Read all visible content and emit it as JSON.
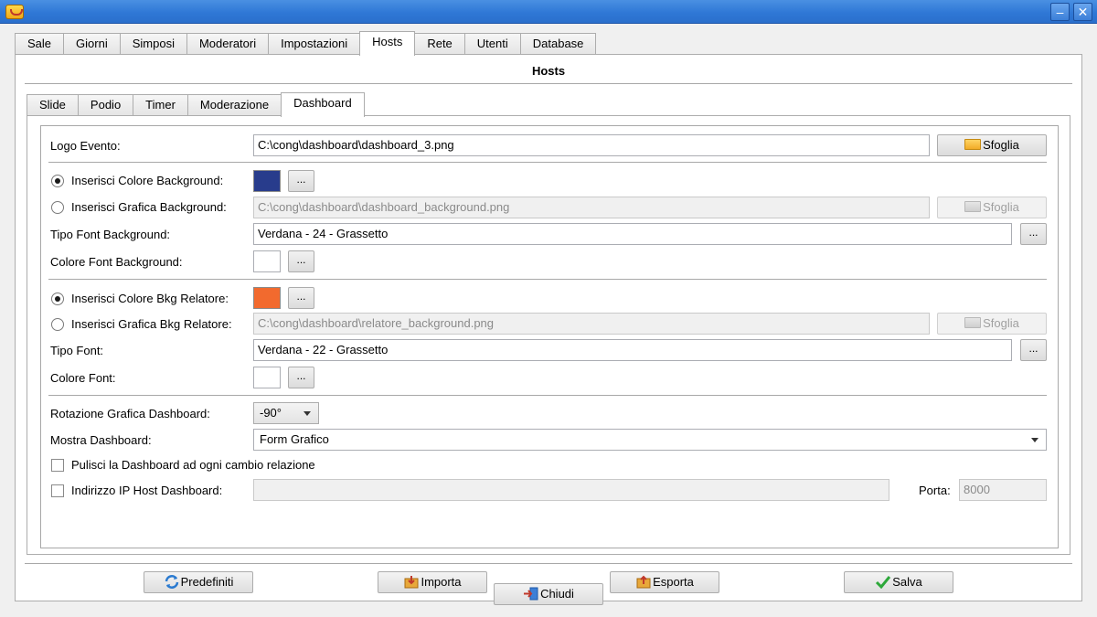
{
  "outer_tabs": [
    "Sale",
    "Giorni",
    "Simposi",
    "Moderatori",
    "Impostazioni",
    "Hosts",
    "Rete",
    "Utenti",
    "Database"
  ],
  "outer_active": "Hosts",
  "panel_title": "Hosts",
  "inner_tabs": [
    "Slide",
    "Podio",
    "Timer",
    "Moderazione",
    "Dashboard"
  ],
  "inner_active": "Dashboard",
  "form": {
    "logo_label": "Logo Evento:",
    "logo_value": "C:\\cong\\dashboard\\dashboard_3.png",
    "browse_label": "Sfoglia",
    "dots_label": "...",
    "bg_color_radio": "Inserisci Colore Background:",
    "bg_color": "#283c8c",
    "bg_graphic_radio": "Inserisci Grafica Background:",
    "bg_graphic_value": "C:\\cong\\dashboard\\dashboard_background.png",
    "bg_font_label": "Tipo Font Background:",
    "bg_font_value": "Verdana - 24 - Grassetto",
    "bg_font_color_label": "Colore Font Background:",
    "rel_color_radio": "Inserisci Colore Bkg Relatore:",
    "rel_color": "#f26a2e",
    "rel_graphic_radio": "Inserisci Grafica Bkg Relatore:",
    "rel_graphic_value": "C:\\cong\\dashboard\\relatore_background.png",
    "font_label": "Tipo Font:",
    "font_value": "Verdana - 22 - Grassetto",
    "font_color_label": "Colore Font:",
    "rotation_label": "Rotazione Grafica Dashboard:",
    "rotation_value": "-90°",
    "show_label": "Mostra Dashboard:",
    "show_value": "Form Grafico",
    "clear_label": "Pulisci la Dashboard ad ogni cambio relazione",
    "ip_label": "Indirizzo IP Host Dashboard:",
    "ip_value": "",
    "port_label": "Porta:",
    "port_value": "8000"
  },
  "buttons": {
    "defaults": "Predefiniti",
    "import": "Importa",
    "export": "Esporta",
    "save": "Salva",
    "close": "Chiudi"
  }
}
